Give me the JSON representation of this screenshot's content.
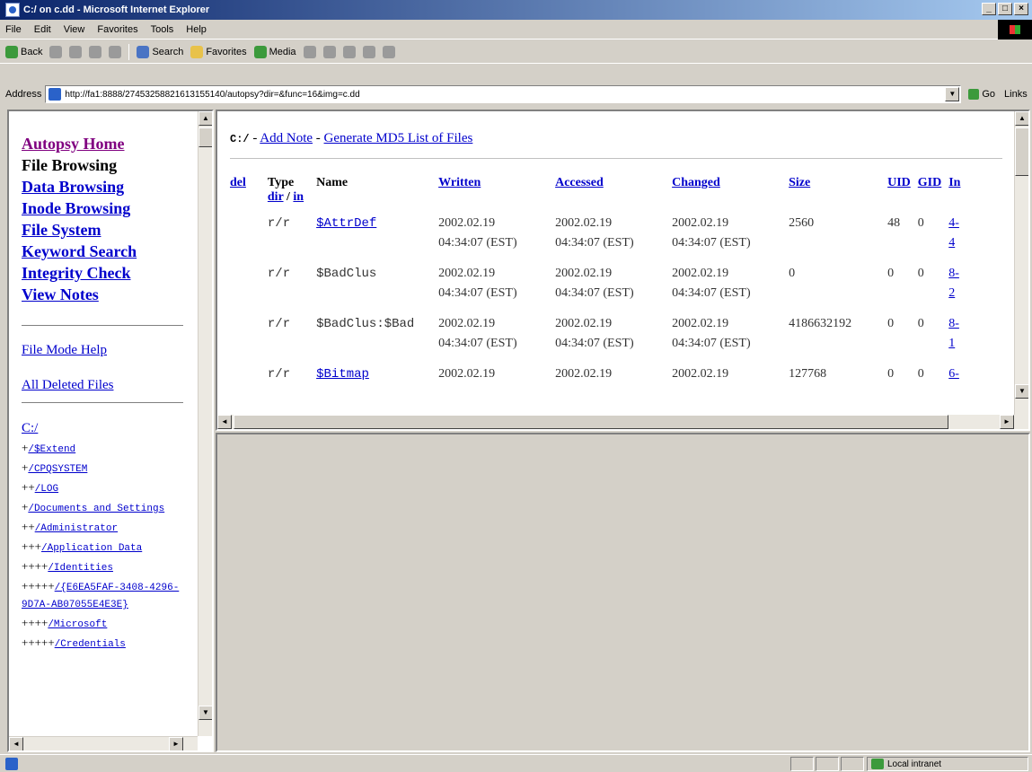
{
  "window": {
    "title": "C:/ on c.dd - Microsoft Internet Explorer",
    "controls": [
      "_",
      "□",
      "×"
    ]
  },
  "menu": [
    "File",
    "Edit",
    "View",
    "Favorites",
    "Tools",
    "Help"
  ],
  "toolbar": {
    "back": "Back",
    "search": "Search",
    "favorites": "Favorites",
    "media": "Media"
  },
  "address": {
    "label": "Address",
    "url": "http://fa1:8888/27453258821613155140/autopsy?dir=&func=16&img=c.dd",
    "go": "Go",
    "links": "Links"
  },
  "nav": {
    "home": "Autopsy Home",
    "current": "File Browsing",
    "items": [
      "Data Browsing",
      "Inode Browsing",
      "File System",
      "Keyword Search",
      "Integrity Check",
      "View Notes"
    ],
    "help": "File Mode Help",
    "deleted": "All Deleted Files"
  },
  "tree": {
    "root": "C:/",
    "rows": [
      {
        "prefix": "+",
        "name": "/$Extend"
      },
      {
        "prefix": "+",
        "name": "/CPQSYSTEM"
      },
      {
        "prefix": "++",
        "name": "/LOG"
      },
      {
        "prefix": "+",
        "name": "/Documents and Settings"
      },
      {
        "prefix": "++",
        "name": "/Administrator"
      },
      {
        "prefix": "+++",
        "name": "/Application Data"
      },
      {
        "prefix": "++++",
        "name": "/Identities"
      },
      {
        "prefix": "+++++",
        "name": "/{E6EA5FAF-3408-4296-9D7A-AB07055E4E3E}"
      },
      {
        "prefix": "++++",
        "name": "/Microsoft"
      },
      {
        "prefix": "+++++",
        "name": "/Credentials"
      }
    ]
  },
  "main": {
    "path": "C:/",
    "add_note": "Add Note",
    "generate_md5": "Generate MD5 List of Files",
    "sep": " - ",
    "headers": {
      "del": "del",
      "type": "Type",
      "type_dir": "dir",
      "type_slash": " / ",
      "type_in": "in",
      "name": "Name",
      "written": "Written",
      "accessed": "Accessed",
      "changed": "Changed",
      "size": "Size",
      "uid": "UID",
      "gid": "GID",
      "inode": "In"
    },
    "rows": [
      {
        "type": "r/r",
        "name": "$AttrDef",
        "name_link": true,
        "written": [
          "2002.02.19",
          "04:34:07 (EST)"
        ],
        "accessed": [
          "2002.02.19",
          "04:34:07 (EST)"
        ],
        "changed": [
          "2002.02.19",
          "04:34:07 (EST)"
        ],
        "size": "2560",
        "uid": "48",
        "gid": "0",
        "inode": [
          "4-",
          "4"
        ]
      },
      {
        "type": "r/r",
        "name": "$BadClus",
        "name_link": false,
        "written": [
          "2002.02.19",
          "04:34:07 (EST)"
        ],
        "accessed": [
          "2002.02.19",
          "04:34:07 (EST)"
        ],
        "changed": [
          "2002.02.19",
          "04:34:07 (EST)"
        ],
        "size": "0",
        "uid": "0",
        "gid": "0",
        "inode": [
          "8-",
          "2"
        ]
      },
      {
        "type": "r/r",
        "name": "$BadClus:$Bad",
        "name_link": false,
        "written": [
          "2002.02.19",
          "04:34:07 (EST)"
        ],
        "accessed": [
          "2002.02.19",
          "04:34:07 (EST)"
        ],
        "changed": [
          "2002.02.19",
          "04:34:07 (EST)"
        ],
        "size": "4186632192",
        "uid": "0",
        "gid": "0",
        "inode": [
          "8-",
          "1"
        ]
      },
      {
        "type": "r/r",
        "name": "$Bitmap",
        "name_link": true,
        "written": [
          "2002.02.19",
          ""
        ],
        "accessed": [
          "2002.02.19",
          ""
        ],
        "changed": [
          "2002.02.19",
          ""
        ],
        "size": "127768",
        "uid": "0",
        "gid": "0",
        "inode": [
          "6-",
          ""
        ]
      }
    ]
  },
  "status": {
    "zone": "Local intranet"
  },
  "colors": {
    "link": "#0000cc",
    "visited": "#800080",
    "title_bar": "#0a246a"
  }
}
